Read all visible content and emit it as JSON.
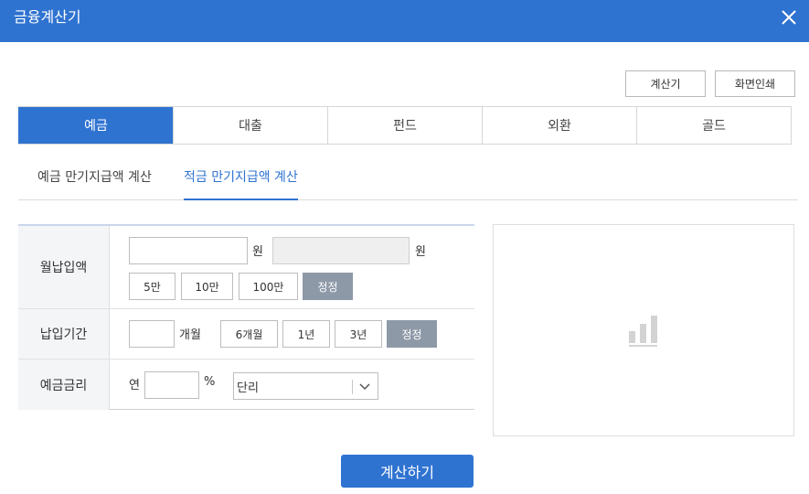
{
  "window": {
    "title": "금융계산기",
    "close_icon": "close-icon"
  },
  "toolbar": {
    "calculator_label": "계산기",
    "print_label": "화면인쇄"
  },
  "main_tabs": [
    {
      "label": "예금",
      "active": true
    },
    {
      "label": "대출",
      "active": false
    },
    {
      "label": "펀드",
      "active": false
    },
    {
      "label": "외환",
      "active": false
    },
    {
      "label": "골드",
      "active": false
    }
  ],
  "sub_tabs": [
    {
      "label": "예금 만기지급액 계산",
      "active": false
    },
    {
      "label": "적금 만기지급액 계산",
      "active": true
    }
  ],
  "form": {
    "monthly_payment": {
      "label": "월납입액",
      "amount_value": "",
      "amount_unit": "원",
      "display_value": "",
      "display_unit": "원",
      "quick_buttons": [
        "5만",
        "10만",
        "100만"
      ],
      "reset_label": "정정"
    },
    "period": {
      "label": "납입기간",
      "months_value": "",
      "months_unit": "개월",
      "quick_buttons": [
        "6개월",
        "1년",
        "3년"
      ],
      "reset_label": "정정"
    },
    "rate": {
      "label": "예금금리",
      "prefix": "연",
      "rate_value": "",
      "rate_unit": "%",
      "interest_type_selected": "단리"
    }
  },
  "chart_panel": {
    "icon": "bar-chart-icon"
  },
  "submit_label": "계산하기",
  "colors": {
    "accent": "#2f73d1",
    "reset_button": "#8e99a8",
    "label_bg": "#f4f5f7"
  }
}
